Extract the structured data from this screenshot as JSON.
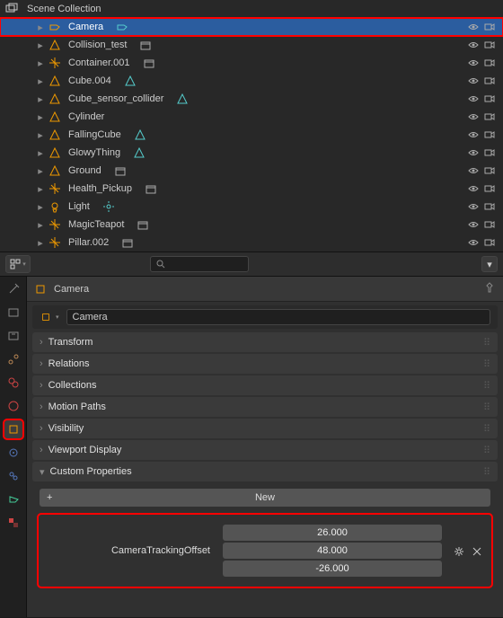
{
  "outliner": {
    "collection": "Scene Collection",
    "items": [
      {
        "name": "Camera",
        "type": "camera",
        "selected": true,
        "data_icon": "camera-data"
      },
      {
        "name": "Collision_test",
        "type": "mesh",
        "mod": "archive"
      },
      {
        "name": "Container.001",
        "type": "empty",
        "mod": "archive"
      },
      {
        "name": "Cube.004",
        "type": "mesh",
        "mod": "triangle"
      },
      {
        "name": "Cube_sensor_collider",
        "type": "mesh",
        "mod": "triangle"
      },
      {
        "name": "Cylinder",
        "type": "mesh"
      },
      {
        "name": "FallingCube",
        "type": "mesh",
        "mod": "triangle"
      },
      {
        "name": "GlowyThing",
        "type": "mesh",
        "mod": "triangle"
      },
      {
        "name": "Ground",
        "type": "mesh",
        "mod": "archive"
      },
      {
        "name": "Health_Pickup",
        "type": "empty",
        "mod": "archive"
      },
      {
        "name": "Light",
        "type": "light",
        "mod": "sun"
      },
      {
        "name": "MagicTeapot",
        "type": "empty",
        "mod": "archive"
      },
      {
        "name": "Pillar.002",
        "type": "empty",
        "mod": "archive"
      }
    ]
  },
  "search": {
    "placeholder": ""
  },
  "props": {
    "object_name": "Camera",
    "breadcrumb_value": "Camera",
    "sections": [
      {
        "title": "Transform",
        "open": false
      },
      {
        "title": "Relations",
        "open": false
      },
      {
        "title": "Collections",
        "open": false
      },
      {
        "title": "Motion Paths",
        "open": false
      },
      {
        "title": "Visibility",
        "open": false
      },
      {
        "title": "Viewport Display",
        "open": false
      },
      {
        "title": "Custom Properties",
        "open": true
      }
    ],
    "new_label": "New",
    "custom_property": {
      "name": "CameraTrackingOffset",
      "values": [
        "26.000",
        "48.000",
        "-26.000"
      ]
    }
  }
}
